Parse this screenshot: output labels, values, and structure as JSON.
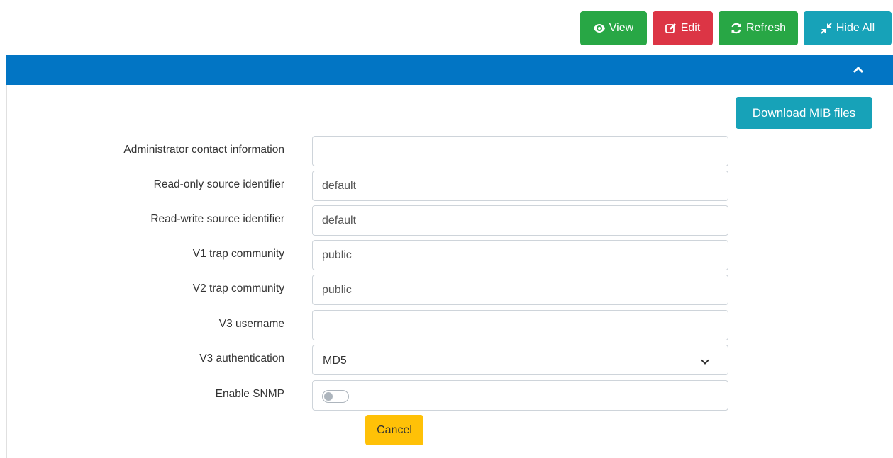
{
  "toolbar": {
    "view_label": "View",
    "edit_label": "Edit",
    "refresh_label": "Refresh",
    "hide_all_label": "Hide All"
  },
  "panel": {
    "download_mib_label": "Download MIB files"
  },
  "form": {
    "admin_contact": {
      "label": "Administrator contact information",
      "value": ""
    },
    "ro_source": {
      "label": "Read-only source identifier",
      "value": "default"
    },
    "rw_source": {
      "label": "Read-write source identifier",
      "value": "default"
    },
    "v1_trap": {
      "label": "V1 trap community",
      "value": "public"
    },
    "v2_trap": {
      "label": "V2 trap community",
      "value": "public"
    },
    "v3_username": {
      "label": "V3 username",
      "value": ""
    },
    "v3_auth": {
      "label": "V3 authentication",
      "value": "MD5"
    },
    "enable_snmp": {
      "label": "Enable SNMP",
      "enabled": false
    }
  },
  "actions": {
    "cancel_label": "Cancel"
  },
  "colors": {
    "header_blue": "#0275c4",
    "success": "#28a745",
    "danger": "#dc3545",
    "info": "#17a2b8",
    "warning": "#ffc107"
  }
}
